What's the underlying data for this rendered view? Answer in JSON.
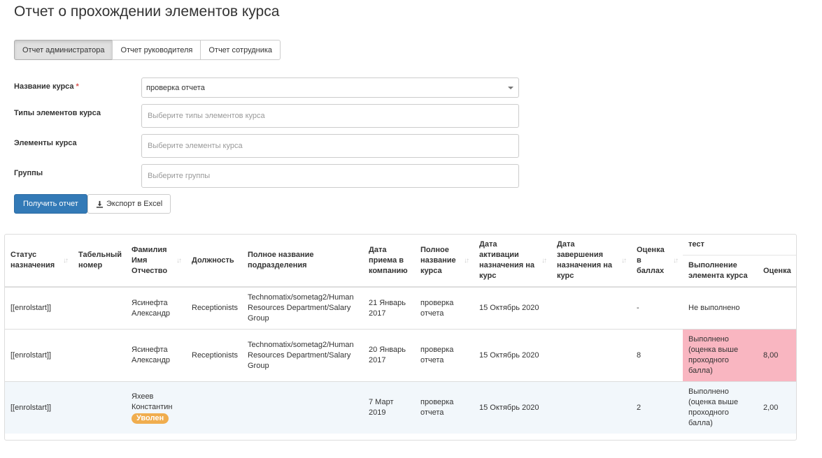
{
  "title": "Отчет о прохождении элементов курса",
  "tabs": [
    {
      "label": "Отчет администратора",
      "active": true
    },
    {
      "label": "Отчет руководителя",
      "active": false
    },
    {
      "label": "Отчет сотрудника",
      "active": false
    }
  ],
  "form": {
    "course_name_label": "Название курса",
    "required_mark": "*",
    "course_name_value": "проверка отчета",
    "element_types_label": "Типы элементов курса",
    "element_types_placeholder": "Выберите типы элементов курса",
    "elements_label": "Элементы курса",
    "elements_placeholder": "Выберите элементы курса",
    "groups_label": "Группы",
    "groups_placeholder": "Выберите группы"
  },
  "buttons": {
    "get_report": "Получить отчет",
    "export_excel": "Экспорт в Excel"
  },
  "table": {
    "columns": {
      "status": "Статус назначения",
      "tab_number": "Табельный номер",
      "full_name": "Фамилия Имя Отчество",
      "position": "Должность",
      "department": "Полное название подразделения",
      "hire_date": "Дата приема в компанию",
      "course_full_name": "Полное название курса",
      "activation_date": "Дата активации назначения на курс",
      "completion_date": "Дата завершения назначения на курс",
      "score_points": "Оценка в баллах",
      "group": "тест",
      "element_completion": "Выполнение элемента курса",
      "grade": "Оценка"
    },
    "rows": [
      {
        "status": "[[enrolstart]]",
        "tab_number": "",
        "full_name": "Ясинефта Александр",
        "badge": "",
        "position": "Receptionists",
        "department": "Technomatix/sometag2/Human Resources Department/Salary Group",
        "hire_date": "21 Январь 2017",
        "course": "проверка отчета",
        "activation_date": "15 Октябрь 2020",
        "completion_date": "",
        "score": "-",
        "element_completion": "Не выполнено",
        "grade": ""
      },
      {
        "status": "[[enrolstart]]",
        "tab_number": "",
        "full_name": "Ясинефта Александр",
        "badge": "",
        "position": "Receptionists",
        "department": "Technomatix/sometag2/Human Resources Department/Salary Group",
        "hire_date": "20 Январь 2017",
        "course": "проверка отчета",
        "activation_date": "15 Октябрь 2020",
        "completion_date": "",
        "score": "8",
        "element_completion": "Выполнено (оценка выше проходного балла)",
        "grade": "8,00"
      },
      {
        "status": "[[enrolstart]]",
        "tab_number": "",
        "full_name": "Яхеев Константин",
        "badge": "Уволен",
        "position": "",
        "department": "",
        "hire_date": "7 Март 2019",
        "course": "проверка отчета",
        "activation_date": "15 Октябрь 2020",
        "completion_date": "",
        "score": "2",
        "element_completion": "Выполнено (оценка выше проходного балла)",
        "grade": "2,00"
      }
    ]
  },
  "colors": {
    "primary": "#337ab7",
    "highlight_row": "#f9b6c1",
    "badge_warning": "#f0ad4e",
    "striped_row": "#f2f7fb"
  }
}
